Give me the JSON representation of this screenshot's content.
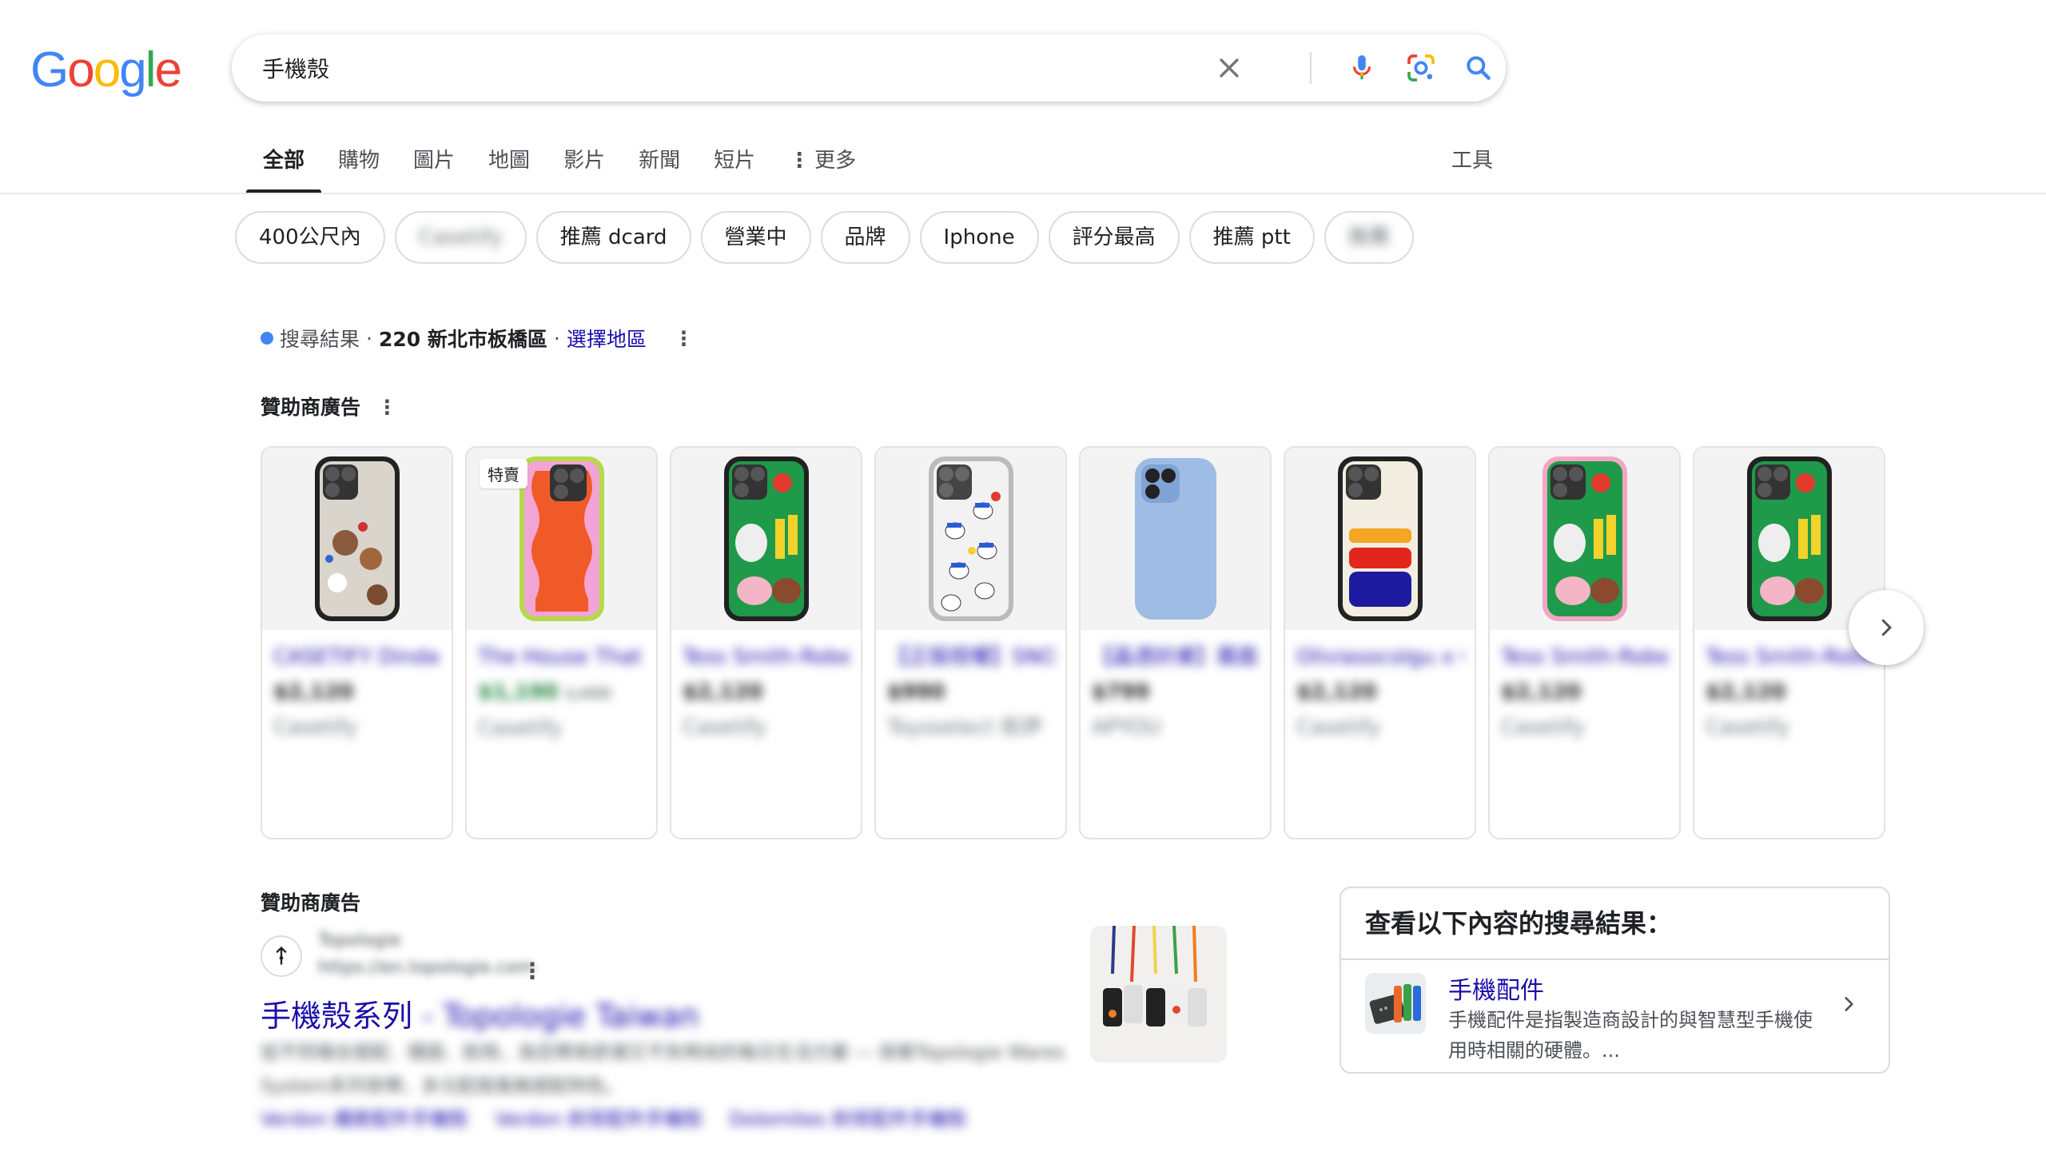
{
  "header": {
    "logo_text": "Google",
    "search_value": "手機殼",
    "search_placeholder": "",
    "icons": [
      "clear-icon",
      "mic-icon",
      "lens-icon",
      "search-icon"
    ]
  },
  "tabs": {
    "items": [
      "全部",
      "購物",
      "圖片",
      "地圖",
      "影片",
      "新聞",
      "短片"
    ],
    "more": "更多",
    "active": "全部",
    "tools": "工具"
  },
  "chips": [
    "400公尺內",
    "Casetify",
    "推薦 dcard",
    "營業中",
    "品牌",
    "Iphone",
    "評分最高",
    "推薦 ptt",
    "推薦"
  ],
  "location": {
    "label": "搜尋結果",
    "area": "220 新北市板橋區",
    "link": "選擇地區"
  },
  "shopping_ads": {
    "heading": "贊助商廣告",
    "badge": "特賣",
    "products": [
      {
        "title": "CASETIFY Dindaeng 熊...",
        "price": "$2,120",
        "shop": "Casetify"
      },
      {
        "title": "The House That Lars Bu...",
        "price": "$1,190",
        "original": "1,490",
        "shop": "Casetify"
      },
      {
        "title": "Tess Smith-Roberts x...",
        "price": "$2,120",
        "shop": "Casetify"
      },
      {
        "title": "【正版授權】SNOOPY史...",
        "price": "$990",
        "shop": "Toysselect 拓伊"
      },
      {
        "title": "【晶透好膚】霧面透iPhone ...",
        "price": "$799",
        "shop": "APYOU"
      },
      {
        "title": "Oliviasocolgu x CASETIFY...",
        "price": "$2,120",
        "shop": "Casetify"
      },
      {
        "title": "Tess Smith-Roberts x...",
        "price": "$2,120",
        "shop": "Casetify"
      },
      {
        "title": "Tess Smith-Roberts x...",
        "price": "$2,120",
        "shop": "Casetify"
      }
    ]
  },
  "text_ad": {
    "heading": "贊助商廣告",
    "site_name": "Topologie",
    "site_url": "https://en.topologie.com",
    "title_main": "手機殼系列",
    "title_rest": " - Topologie Taiwan",
    "description": "從不同場合搭配．穩固．耐用，為您帶來舒適又不失時尚的每日生活方案 — 探索Topologie Wares System系列背帶，多元配搭風格搭配特色。",
    "links": [
      "Verdon 繩索配件手機殼",
      "Verdon 斜背配件手機殼",
      "Dolomites 斜背配件手機殼"
    ]
  },
  "side_box": {
    "heading": "查看以下內容的搜尋結果：",
    "name": "手機配件",
    "description": "手機配件是指製造商設計的與智慧型手機使用時相關的硬體。..."
  },
  "colors": {
    "link": "#1a0dab",
    "google_blue": "#4285f4",
    "google_red": "#ea4335",
    "google_yellow": "#fbbc05",
    "google_green": "#34a853"
  }
}
